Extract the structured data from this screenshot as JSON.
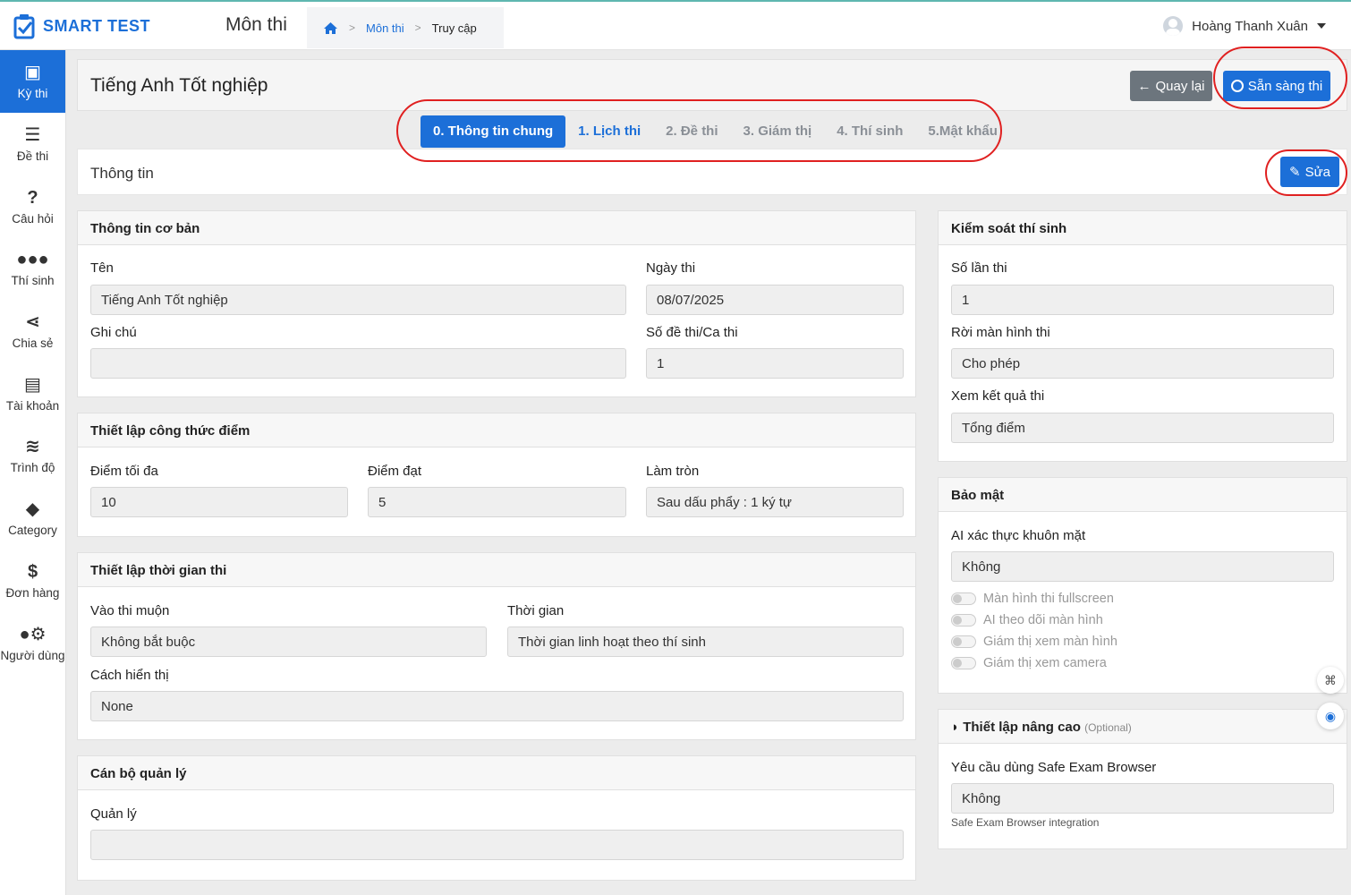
{
  "app": {
    "name": "SMART TEST",
    "module": "Môn thi"
  },
  "breadcrumb": {
    "item1": "Môn thi",
    "item2": "Truy cập"
  },
  "user": {
    "name": "Hoàng Thanh Xuân"
  },
  "sidebar": {
    "items": [
      {
        "label": "Kỳ thi",
        "icon": "briefcase-clock-icon"
      },
      {
        "label": "Đề thi",
        "icon": "list-icon"
      },
      {
        "label": "Câu hỏi",
        "icon": "question-icon"
      },
      {
        "label": "Thí sinh",
        "icon": "users-icon"
      },
      {
        "label": "Chia sẻ",
        "icon": "share-icon"
      },
      {
        "label": "Tài khoản",
        "icon": "id-card-icon"
      },
      {
        "label": "Trình độ",
        "icon": "layers-icon"
      },
      {
        "label": "Category",
        "icon": "tags-icon"
      },
      {
        "label": "Đơn hàng",
        "icon": "dollar-icon"
      },
      {
        "label": "Người dùng",
        "icon": "users-cog-icon"
      }
    ]
  },
  "page": {
    "title": "Tiếng Anh Tốt nghiệp",
    "back_label": "Quay lại",
    "ready_label": "Sẵn sàng thi"
  },
  "tabs": [
    "0. Thông tin chung",
    "1. Lịch thi",
    "2. Đề thi",
    "3. Giám thị",
    "4. Thí sinh",
    "5.Mật khẩu"
  ],
  "info": {
    "title": "Thông tin",
    "edit_label": "Sửa"
  },
  "basic": {
    "title": "Thông tin cơ bản",
    "name_label": "Tên",
    "name_value": "Tiếng Anh Tốt nghiệp",
    "date_label": "Ngày thi",
    "date_value": "08/07/2025",
    "note_label": "Ghi chú",
    "note_value": "",
    "count_label": "Số đề thi/Ca thi",
    "count_value": "1"
  },
  "score": {
    "title": "Thiết lập công thức điểm",
    "max_label": "Điểm tối đa",
    "max_value": "10",
    "pass_label": "Điểm đạt",
    "pass_value": "5",
    "round_label": "Làm tròn",
    "round_value": "Sau dấu phẩy : 1 ký tự"
  },
  "time": {
    "title": "Thiết lập thời gian thi",
    "late_label": "Vào thi muộn",
    "late_value": "Không bắt buộc",
    "duration_label": "Thời gian",
    "duration_value": "Thời gian linh hoạt theo thí sinh",
    "display_label": "Cách hiển thị",
    "display_value": "None"
  },
  "manager": {
    "title": "Cán bộ quản lý",
    "label": "Quản lý",
    "value": ""
  },
  "control": {
    "title": "Kiểm soát thí sinh",
    "attempts_label": "Số lần thi",
    "attempts_value": "1",
    "leave_label": "Rời màn hình thi",
    "leave_value": "Cho phép",
    "result_label": "Xem kết quả thi",
    "result_value": "Tổng điểm"
  },
  "security": {
    "title": "Bảo mật",
    "face_label": "AI xác thực khuôn mặt",
    "face_value": "Không",
    "toggles": [
      "Màn hình thi fullscreen",
      "AI theo dõi màn hình",
      "Giám thị xem màn hình",
      "Giám thị xem camera"
    ]
  },
  "advanced": {
    "title": "Thiết lập nâng cao",
    "optional": "(Optional)",
    "seb_label": "Yêu cầu dùng Safe Exam Browser",
    "seb_value": "Không",
    "seb_hint": "Safe Exam Browser integration"
  },
  "colors": {
    "primary": "#1c6fd8",
    "secondary": "#6c757d",
    "annotation": "#e02020"
  }
}
